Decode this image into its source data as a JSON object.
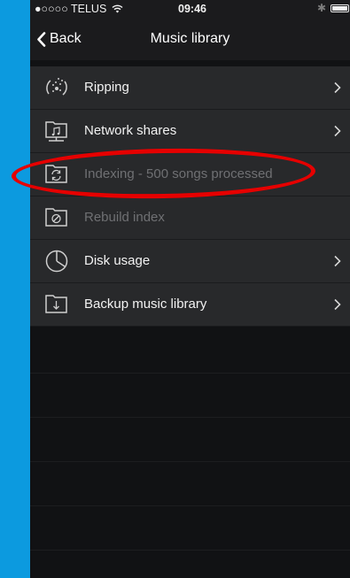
{
  "status_bar": {
    "carrier": "●○○○○ TELUS",
    "wifi_icon": "wifi-icon",
    "time": "09:46",
    "bluetooth_icon": "✱",
    "battery_icon": "battery-full-icon"
  },
  "nav": {
    "back_label": "Back",
    "title": "Music library"
  },
  "items": [
    {
      "label": "Ripping",
      "icon": "ripping-icon",
      "enabled": true
    },
    {
      "label": "Network shares",
      "icon": "network-folder-icon",
      "enabled": true
    },
    {
      "label": "Indexing - 500 songs processed",
      "icon": "sync-folder-icon",
      "enabled": false
    },
    {
      "label": "Rebuild index",
      "icon": "blocked-folder-icon",
      "enabled": false
    },
    {
      "label": "Disk usage",
      "icon": "pie-chart-icon",
      "enabled": true
    },
    {
      "label": "Backup music library",
      "icon": "backup-folder-icon",
      "enabled": true
    }
  ],
  "colors": {
    "accent_background": "#0c9adf",
    "annotation": "#e60000",
    "row_background": "#28292b",
    "disabled_text": "#6f7073"
  }
}
